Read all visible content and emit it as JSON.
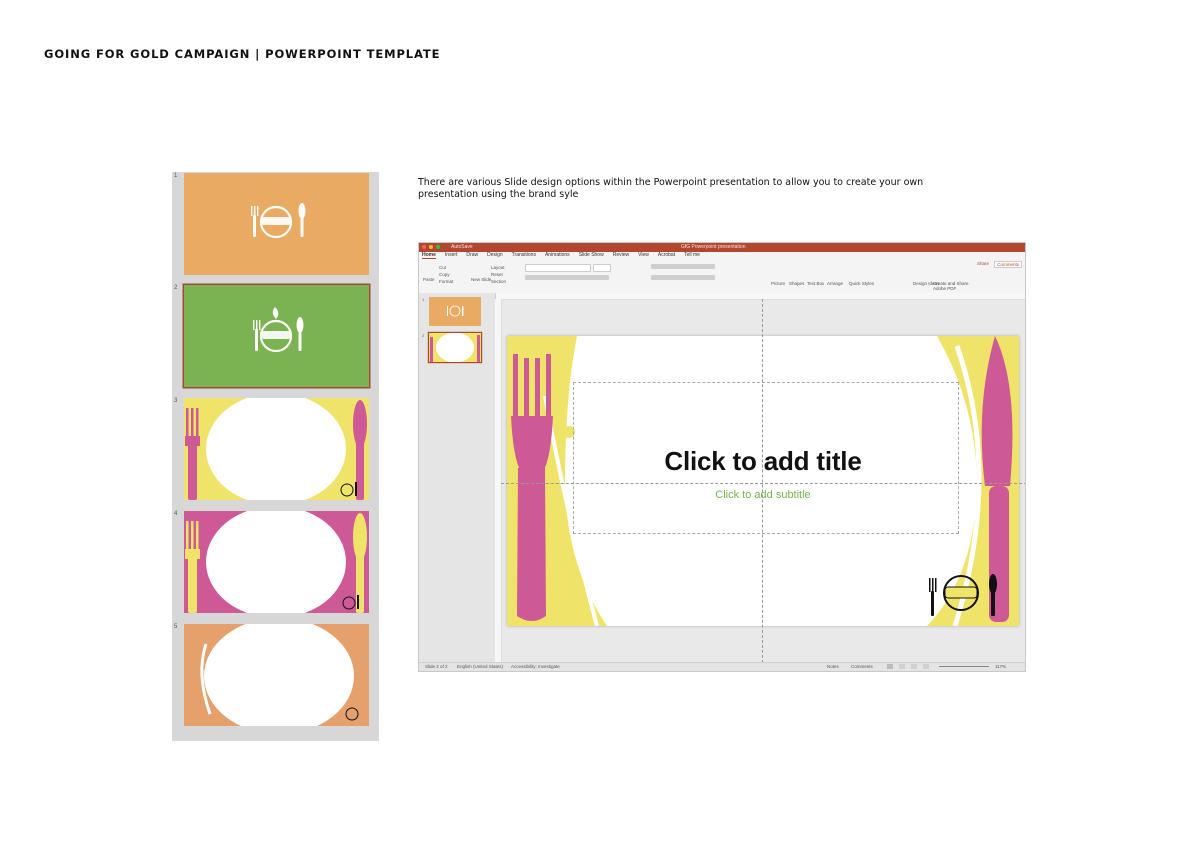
{
  "document": {
    "title": "GOING FOR GOLD CAMPAIGN | POWERPOINT TEMPLATE",
    "caption": "There are various Slide design options within the Powerpoint presentation to allow you to create your own presentation using the brand syle"
  },
  "colors": {
    "orange": "#e9aa63",
    "green": "#7cb352",
    "yellow": "#f0e36a",
    "pink": "#cd5a96",
    "peach": "#e5a06c",
    "ppt_accent": "#b2472f"
  },
  "thumbnails": [
    {
      "number": "1",
      "style": "orange-logo"
    },
    {
      "number": "2",
      "style": "green-logo",
      "selected": true
    },
    {
      "number": "3",
      "style": "yellow-plate-pink-cutlery"
    },
    {
      "number": "4",
      "style": "pink-plate-yellow-cutlery"
    },
    {
      "number": "5",
      "style": "orange-plate"
    }
  ],
  "ppt": {
    "autosave": "AutoSave",
    "filename": "GfG Powerpoint presentation",
    "menu": [
      "Home",
      "Insert",
      "Draw",
      "Design",
      "Transitions",
      "Animations",
      "Slide Show",
      "Review",
      "View",
      "Acrobat",
      "Tell me"
    ],
    "share": "Share",
    "comments": "Comments",
    "ribbon": {
      "paste": "Paste",
      "cut": "Cut",
      "copy": "Copy",
      "format": "Format",
      "new_slide": "New Slide",
      "layout": "Layout",
      "reset": "Reset",
      "section": "Section",
      "picture": "Picture",
      "shapes": "Shapes",
      "text_box": "Text Box",
      "arrange": "Arrange",
      "quick_styles": "Quick Styles",
      "design_ideas": "Design Ideas",
      "create_pdf": "Create and Share Adobe PDF"
    },
    "panel_slides": [
      {
        "number": "1"
      },
      {
        "number": "2"
      }
    ],
    "slide": {
      "title": "Click to add title",
      "subtitle": "Click to add subtitle"
    },
    "status": {
      "slide": "Slide 2 of 2",
      "language": "English (United States)",
      "accessibility": "Accessibility: Investigate",
      "notes": "Notes",
      "comments": "Comments",
      "zoom": "117%"
    }
  }
}
